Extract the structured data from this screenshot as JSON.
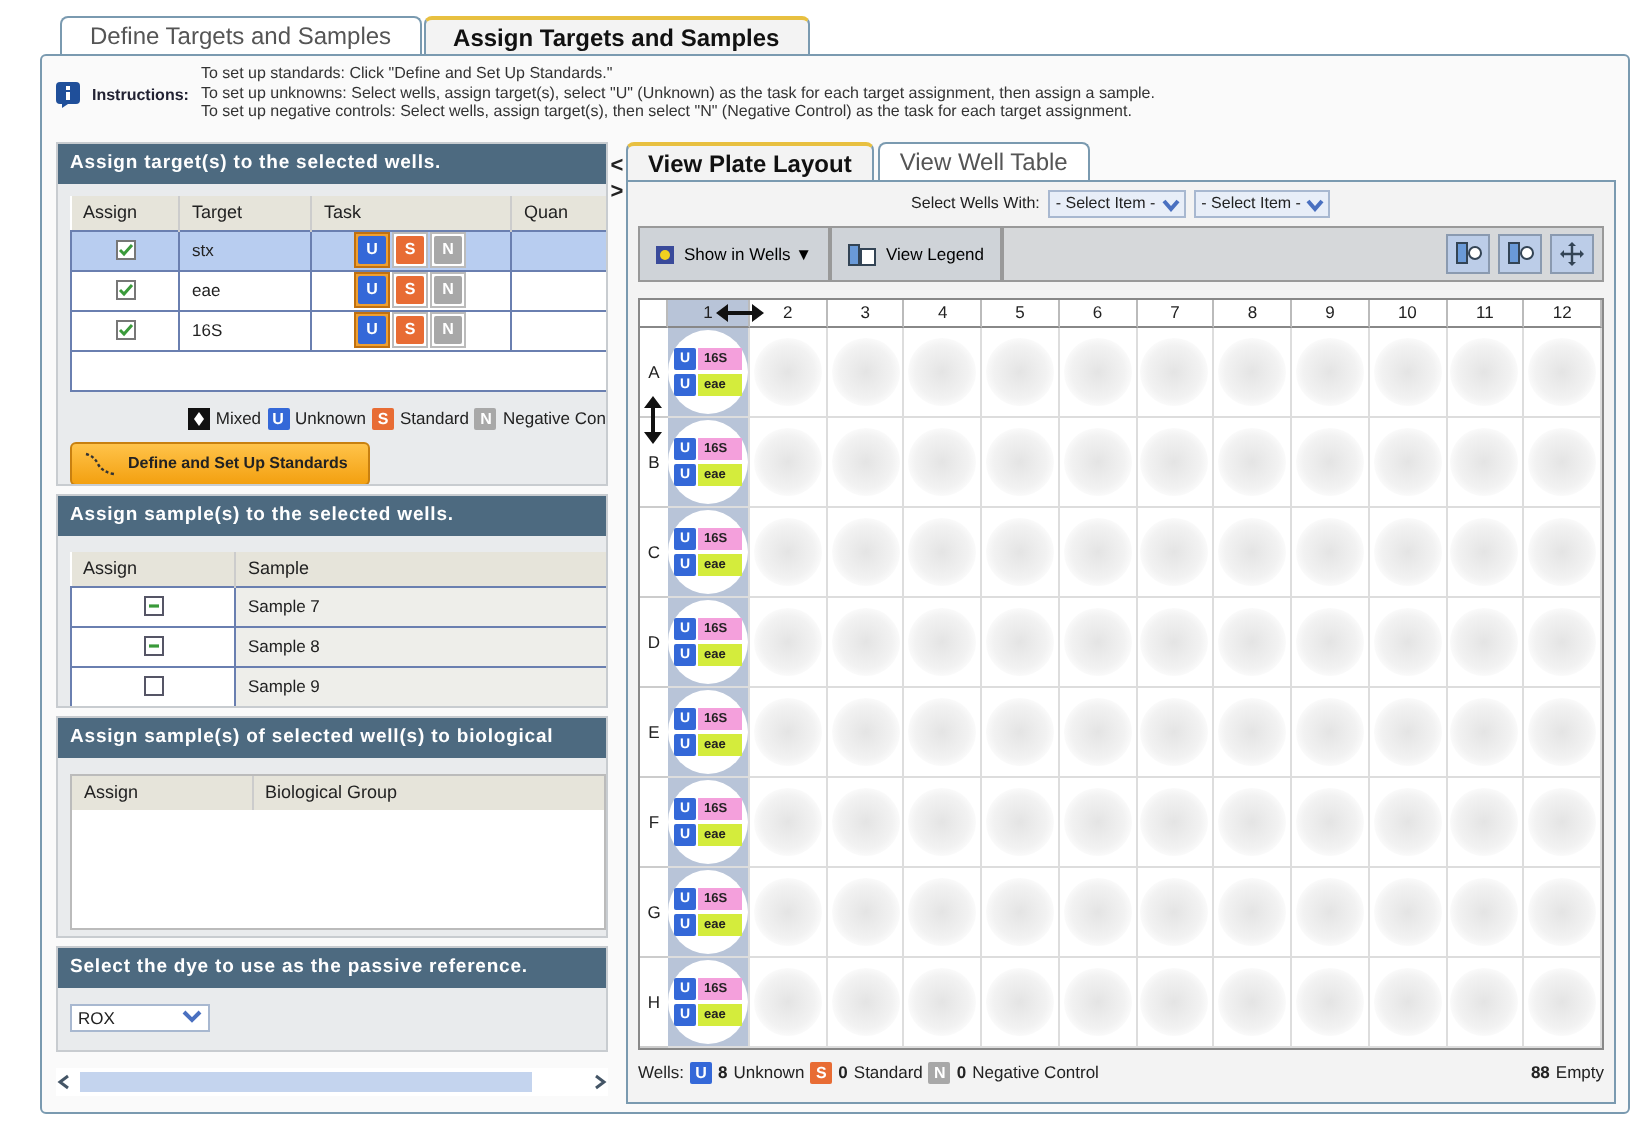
{
  "main_tabs": [
    {
      "label": "Define Targets and Samples",
      "selected": false
    },
    {
      "label": "Assign Targets and Samples",
      "selected": true
    }
  ],
  "instructions": {
    "label": "Instructions:",
    "lines": [
      "To set up standards: Click \"Define and Set Up Standards.\"",
      "To set up unknowns: Select wells, assign target(s), select \"U\" (Unknown) as the task for each target assignment, then assign a sample.",
      "To set up negative controls: Select wells, assign target(s), then select \"N\" (Negative Control) as the task for each target assignment."
    ]
  },
  "targets_panel": {
    "title": "Assign target(s) to the selected wells.",
    "columns": [
      "Assign",
      "Target",
      "Task",
      "Quan"
    ],
    "rows": [
      {
        "checked": true,
        "target": "stx",
        "selected": true,
        "tasks": [
          {
            "kind": "unknown",
            "letter": "U",
            "selected": true
          },
          {
            "kind": "standard",
            "letter": "S",
            "selected": false
          },
          {
            "kind": "negative",
            "letter": "N",
            "selected": false
          }
        ]
      },
      {
        "checked": true,
        "target": "eae",
        "selected": false,
        "tasks": [
          {
            "kind": "unknown",
            "letter": "U",
            "selected": true
          },
          {
            "kind": "standard",
            "letter": "S",
            "selected": false
          },
          {
            "kind": "negative",
            "letter": "N",
            "selected": false
          }
        ]
      },
      {
        "checked": true,
        "target": "16S",
        "selected": false,
        "tasks": [
          {
            "kind": "unknown",
            "letter": "U",
            "selected": true
          },
          {
            "kind": "standard",
            "letter": "S",
            "selected": false
          },
          {
            "kind": "negative",
            "letter": "N",
            "selected": false
          }
        ]
      }
    ],
    "legend": [
      {
        "kind": "mixed",
        "label": "Mixed"
      },
      {
        "kind": "unknown",
        "letter": "U",
        "label": "Unknown"
      },
      {
        "kind": "standard",
        "letter": "S",
        "label": "Standard"
      },
      {
        "kind": "negative",
        "letter": "N",
        "label": "Negative Con"
      }
    ],
    "button": "Define and Set Up Standards"
  },
  "collapse_buttons": [
    "<",
    ">"
  ],
  "samples_panel": {
    "title": "Assign sample(s) to the selected wells.",
    "columns": [
      "Assign",
      "Sample"
    ],
    "rows": [
      {
        "checked": false,
        "indeterminate": true,
        "sample": "Sample 7"
      },
      {
        "checked": false,
        "indeterminate": true,
        "sample": "Sample 8"
      },
      {
        "checked": false,
        "indeterminate": false,
        "sample": "Sample 9"
      }
    ]
  },
  "groups_panel": {
    "title": "Assign sample(s) of selected well(s) to biological",
    "columns": [
      "Assign",
      "Biological Group"
    ]
  },
  "dye_panel": {
    "title": "Select the dye to use as the passive reference.",
    "value": "ROX"
  },
  "view_tabs": [
    {
      "label": "View Plate Layout",
      "selected": true
    },
    {
      "label": "View Well Table",
      "selected": false
    }
  ],
  "select_wells": {
    "label": "Select Wells With:",
    "selects": [
      "- Select Item -",
      "- Select Item -"
    ]
  },
  "toolbar": {
    "show_in_wells": "Show in Wells ▼",
    "view_legend": "View Legend"
  },
  "plate": {
    "columns": [
      "1",
      "2",
      "3",
      "4",
      "5",
      "6",
      "7",
      "8",
      "9",
      "10",
      "11",
      "12"
    ],
    "rows": [
      {
        "label": "A",
        "wells": [
          {
            "kind": "assigned",
            "tags": [
              {
                "letter": "U",
                "target": "16S",
                "color": "#f4a0dc"
              },
              {
                "letter": "U",
                "target": "eae",
                "color": "#d4ec3c"
              }
            ]
          },
          {
            "kind": "empty"
          },
          {
            "kind": "empty"
          },
          {
            "kind": "empty"
          },
          {
            "kind": "empty"
          },
          {
            "kind": "empty"
          },
          {
            "kind": "empty"
          },
          {
            "kind": "empty"
          },
          {
            "kind": "empty"
          },
          {
            "kind": "empty"
          },
          {
            "kind": "empty"
          },
          {
            "kind": "empty"
          }
        ]
      },
      {
        "label": "B",
        "wells": [
          {
            "kind": "assigned",
            "tags": [
              {
                "letter": "U",
                "target": "16S",
                "color": "#f4a0dc"
              },
              {
                "letter": "U",
                "target": "eae",
                "color": "#d4ec3c"
              }
            ]
          },
          {
            "kind": "empty"
          },
          {
            "kind": "empty"
          },
          {
            "kind": "empty"
          },
          {
            "kind": "empty"
          },
          {
            "kind": "empty"
          },
          {
            "kind": "empty"
          },
          {
            "kind": "empty"
          },
          {
            "kind": "empty"
          },
          {
            "kind": "empty"
          },
          {
            "kind": "empty"
          },
          {
            "kind": "empty"
          }
        ]
      },
      {
        "label": "C",
        "wells": [
          {
            "kind": "assigned",
            "tags": [
              {
                "letter": "U",
                "target": "16S",
                "color": "#f4a0dc"
              },
              {
                "letter": "U",
                "target": "eae",
                "color": "#d4ec3c"
              }
            ]
          },
          {
            "kind": "empty"
          },
          {
            "kind": "empty"
          },
          {
            "kind": "empty"
          },
          {
            "kind": "empty"
          },
          {
            "kind": "empty"
          },
          {
            "kind": "empty"
          },
          {
            "kind": "empty"
          },
          {
            "kind": "empty"
          },
          {
            "kind": "empty"
          },
          {
            "kind": "empty"
          },
          {
            "kind": "empty"
          }
        ]
      },
      {
        "label": "D",
        "wells": [
          {
            "kind": "assigned",
            "tags": [
              {
                "letter": "U",
                "target": "16S",
                "color": "#f4a0dc"
              },
              {
                "letter": "U",
                "target": "eae",
                "color": "#d4ec3c"
              }
            ]
          },
          {
            "kind": "empty"
          },
          {
            "kind": "empty"
          },
          {
            "kind": "empty"
          },
          {
            "kind": "empty"
          },
          {
            "kind": "empty"
          },
          {
            "kind": "empty"
          },
          {
            "kind": "empty"
          },
          {
            "kind": "empty"
          },
          {
            "kind": "empty"
          },
          {
            "kind": "empty"
          },
          {
            "kind": "empty"
          }
        ]
      },
      {
        "label": "E",
        "wells": [
          {
            "kind": "assigned",
            "tags": [
              {
                "letter": "U",
                "target": "16S",
                "color": "#f4a0dc"
              },
              {
                "letter": "U",
                "target": "eae",
                "color": "#d4ec3c"
              }
            ]
          },
          {
            "kind": "empty"
          },
          {
            "kind": "empty"
          },
          {
            "kind": "empty"
          },
          {
            "kind": "empty"
          },
          {
            "kind": "empty"
          },
          {
            "kind": "empty"
          },
          {
            "kind": "empty"
          },
          {
            "kind": "empty"
          },
          {
            "kind": "empty"
          },
          {
            "kind": "empty"
          },
          {
            "kind": "empty"
          }
        ]
      },
      {
        "label": "F",
        "wells": [
          {
            "kind": "assigned",
            "tags": [
              {
                "letter": "U",
                "target": "16S",
                "color": "#f4a0dc"
              },
              {
                "letter": "U",
                "target": "eae",
                "color": "#d4ec3c"
              }
            ]
          },
          {
            "kind": "empty"
          },
          {
            "kind": "empty"
          },
          {
            "kind": "empty"
          },
          {
            "kind": "empty"
          },
          {
            "kind": "empty"
          },
          {
            "kind": "empty"
          },
          {
            "kind": "empty"
          },
          {
            "kind": "empty"
          },
          {
            "kind": "empty"
          },
          {
            "kind": "empty"
          },
          {
            "kind": "empty"
          }
        ]
      },
      {
        "label": "G",
        "wells": [
          {
            "kind": "assigned",
            "tags": [
              {
                "letter": "U",
                "target": "16S",
                "color": "#f4a0dc"
              },
              {
                "letter": "U",
                "target": "eae",
                "color": "#d4ec3c"
              }
            ]
          },
          {
            "kind": "empty"
          },
          {
            "kind": "empty"
          },
          {
            "kind": "empty"
          },
          {
            "kind": "empty"
          },
          {
            "kind": "empty"
          },
          {
            "kind": "empty"
          },
          {
            "kind": "empty"
          },
          {
            "kind": "empty"
          },
          {
            "kind": "empty"
          },
          {
            "kind": "empty"
          },
          {
            "kind": "empty"
          }
        ]
      },
      {
        "label": "H",
        "wells": [
          {
            "kind": "assigned",
            "tags": [
              {
                "letter": "U",
                "target": "16S",
                "color": "#f4a0dc"
              },
              {
                "letter": "U",
                "target": "eae",
                "color": "#d4ec3c"
              }
            ]
          },
          {
            "kind": "empty"
          },
          {
            "kind": "empty"
          },
          {
            "kind": "empty"
          },
          {
            "kind": "empty"
          },
          {
            "kind": "empty"
          },
          {
            "kind": "empty"
          },
          {
            "kind": "empty"
          },
          {
            "kind": "empty"
          },
          {
            "kind": "empty"
          },
          {
            "kind": "empty"
          },
          {
            "kind": "empty"
          }
        ]
      }
    ]
  },
  "footer": {
    "label": "Wells:",
    "counts": [
      {
        "kind": "unknown",
        "letter": "U",
        "count": "8",
        "label": "Unknown"
      },
      {
        "kind": "standard",
        "letter": "S",
        "count": "0",
        "label": "Standard"
      },
      {
        "kind": "negative",
        "letter": "N",
        "count": "0",
        "label": "Negative Control"
      }
    ],
    "empty_count": "88",
    "empty_label": "Empty"
  }
}
